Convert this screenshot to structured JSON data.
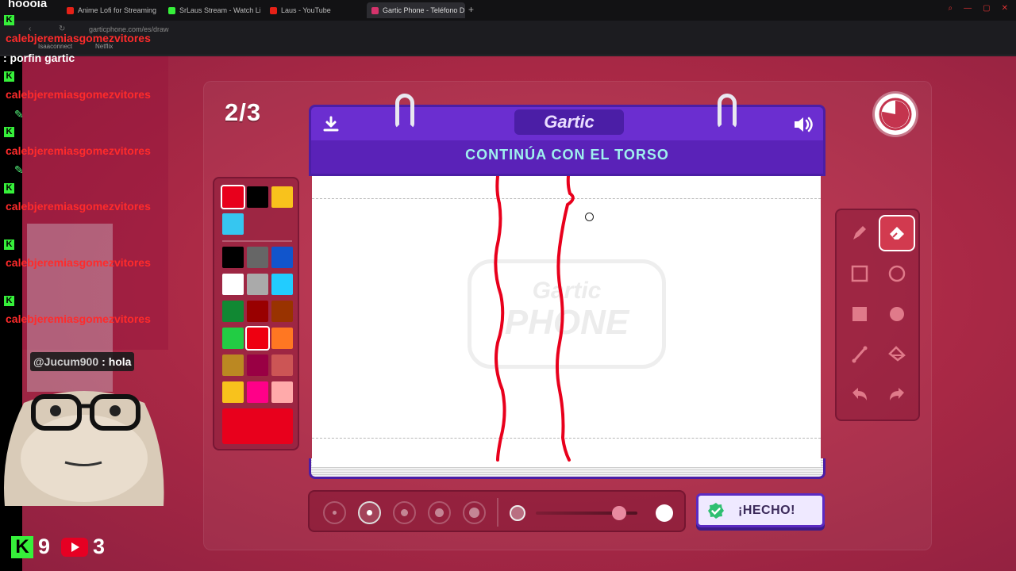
{
  "browser": {
    "tabs": [
      {
        "label": "Anime Lofi for Streaming",
        "favicon_color": "#e62117"
      },
      {
        "label": "SrLaus Stream - Watch Li",
        "favicon_color": "#36f03a"
      },
      {
        "label": "Laus - YouTube",
        "favicon_color": "#e62117"
      },
      {
        "label": "Gartic Phone - Teléfono D",
        "favicon_color": "#d6336c"
      }
    ],
    "url": "garticphone.com/es/draw",
    "bookmarks": [
      "Isaaconnect",
      "Netflix"
    ]
  },
  "game": {
    "round": "2/3",
    "logo": "Gartic",
    "instruction": "CONTINÚA CON EL TORSO",
    "watermark_line1": "Gartic",
    "watermark_line2": "PHONE",
    "timer_remaining_fraction": 0.78,
    "done_label": "¡HECHO!",
    "palette_top": [
      "#e8001c",
      "#000000",
      "#f8c21c",
      "#36c6f0"
    ],
    "palette_grid": [
      "#000000",
      "#666666",
      "#1155cc",
      "#ffffff",
      "#aaaaaa",
      "#22ccff",
      "#118833",
      "#990000",
      "#993300",
      "#22cc44",
      "#ee0011",
      "#ff7722",
      "#bb8822",
      "#990044",
      "#cc5555",
      "#f8c21c",
      "#ff0088",
      "#ffaaaa"
    ],
    "selected_color": "#e8001c",
    "tools": [
      "pencil-icon",
      "eraser-icon",
      "square-outline-icon",
      "circle-outline-icon",
      "square-filled-icon",
      "circle-filled-icon",
      "line-icon",
      "fill-bucket-icon",
      "undo-icon",
      "redo-icon"
    ],
    "selected_tool": "eraser-icon",
    "brush_sizes": [
      1,
      2,
      3,
      4,
      5
    ],
    "selected_brush_size": 2,
    "opacity_value": 0.82,
    "colors": {
      "frame": "#6b2ed0",
      "instruction": "#9ff0ee",
      "accent": "#d23a4f"
    }
  },
  "overlay": {
    "streamer_nick": "hoooia",
    "chat": [
      {
        "type": "name",
        "text": "calebjeremiasgomezvitores"
      },
      {
        "type": "msg",
        "text": ": porfin gartic"
      },
      {
        "type": "name",
        "text": "calebjeremiasgomezvitores"
      },
      {
        "type": "name",
        "text": "calebjeremiasgomezvitores"
      },
      {
        "type": "name",
        "text": "calebjeremiasgomezvitores"
      },
      {
        "type": "name",
        "text": "calebjeremiasgomezvitores"
      },
      {
        "type": "name",
        "text": "calebjeremiasgomezvitores"
      }
    ],
    "yt_message": {
      "user": "@Jucum900",
      "text": ": hola"
    },
    "kick_count": "9",
    "yt_count": "3",
    "kick_letter": "K"
  }
}
